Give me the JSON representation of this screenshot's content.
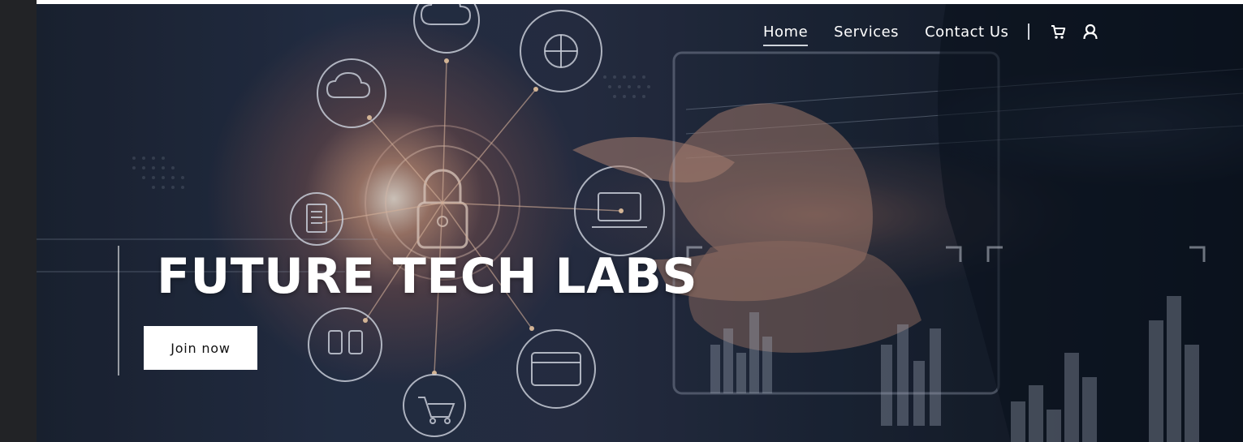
{
  "nav": {
    "items": [
      {
        "label": "Home",
        "active": true
      },
      {
        "label": "Services",
        "active": false
      },
      {
        "label": "Contact Us",
        "active": false
      }
    ],
    "icons": [
      "cart-icon",
      "account-icon"
    ]
  },
  "hero": {
    "title": "FUTURE TECH LABS",
    "cta_label": "Join now"
  },
  "colors": {
    "page_bg": "#202124",
    "nav_text": "#ffffff",
    "cta_bg": "#ffffff",
    "cta_text": "#111111"
  }
}
